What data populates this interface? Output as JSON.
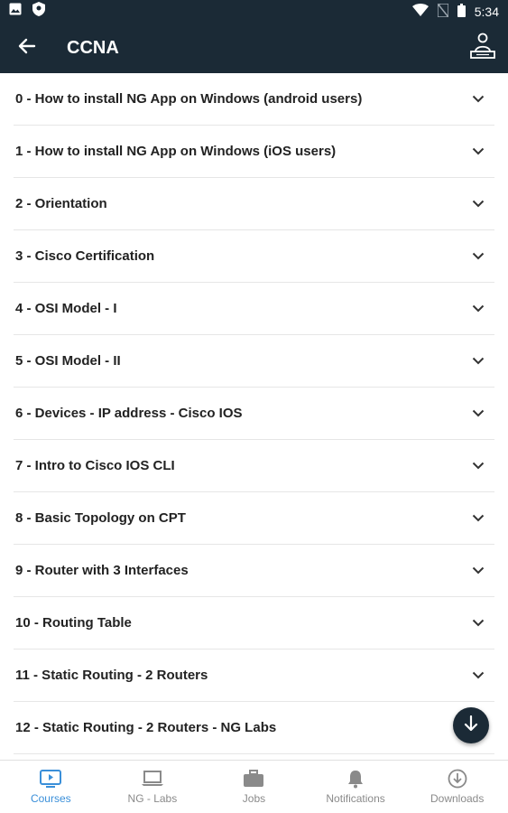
{
  "status_bar": {
    "time": "5:34",
    "left_icons": [
      "image-icon",
      "shield-icon"
    ],
    "right_icons": [
      "wifi-icon",
      "no-sim-icon",
      "battery-icon"
    ]
  },
  "app_bar": {
    "title": "CCNA",
    "back_icon": "arrow-left-icon",
    "right_icon": "instructor-icon"
  },
  "lessons": [
    {
      "label": "0 - How to install NG App on Windows (android users)"
    },
    {
      "label": "1 - How to install NG App on Windows (iOS users)"
    },
    {
      "label": "2 - Orientation"
    },
    {
      "label": "3 - Cisco Certification"
    },
    {
      "label": "4 - OSI Model - I"
    },
    {
      "label": "5 - OSI Model - II"
    },
    {
      "label": "6 - Devices - IP address - Cisco IOS"
    },
    {
      "label": "7 - Intro to Cisco IOS CLI"
    },
    {
      "label": "8 - Basic Topology on CPT"
    },
    {
      "label": "9 - Router with 3 Interfaces"
    },
    {
      "label": "10 - Routing Table"
    },
    {
      "label": "11 - Static Routing - 2 Routers"
    },
    {
      "label": "12 - Static Routing -  2 Routers - NG Labs"
    }
  ],
  "fab": {
    "icon": "arrow-down-icon"
  },
  "bottom_nav": {
    "items": [
      {
        "label": "Courses",
        "icon": "play-screen-icon",
        "active": true
      },
      {
        "label": "NG - Labs",
        "icon": "laptop-icon",
        "active": false
      },
      {
        "label": "Jobs",
        "icon": "briefcase-icon",
        "active": false
      },
      {
        "label": "Notifications",
        "icon": "bell-icon",
        "active": false
      },
      {
        "label": "Downloads",
        "icon": "download-circle-icon",
        "active": false
      }
    ]
  },
  "colors": {
    "header": "#1b2a36",
    "active": "#3a8fd9",
    "inactive": "#8a8a8a"
  }
}
